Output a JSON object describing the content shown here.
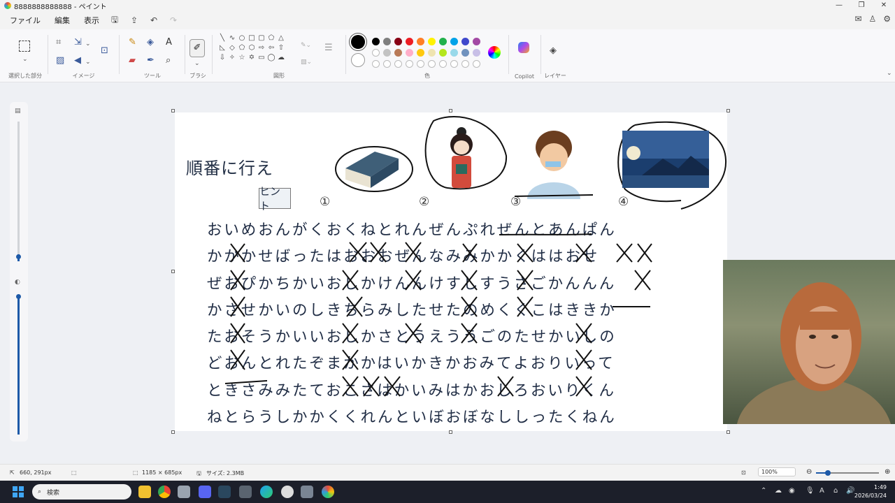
{
  "window": {
    "title": "8888888888888 - ペイント",
    "controls": [
      "—",
      "❐",
      "✕"
    ]
  },
  "menu": {
    "items": [
      "ファイル",
      "編集",
      "表示"
    ]
  },
  "ribbon": {
    "groups": {
      "selection": "選択した部分",
      "image": "イメージ",
      "tools": "ツール",
      "brushes": "ブラシ",
      "shapes": "図形",
      "colors": "色",
      "copilot": "Copilot",
      "layers": "レイヤー"
    },
    "text_tool": "A",
    "palette_top": [
      "#000000",
      "#7f7f7f",
      "#880015",
      "#ed1c24",
      "#ff7f27",
      "#fff200",
      "#22b14c",
      "#00a2e8",
      "#3f48cc",
      "#a349a4"
    ],
    "palette_mid": [
      "#ffffff",
      "#c3c3c3",
      "#b97a57",
      "#ffaec9",
      "#ffc90e",
      "#efe4b0",
      "#b5e61d",
      "#99d9ea",
      "#7092be",
      "#c8bfe7"
    ]
  },
  "canvas": {
    "title": "順番に行え",
    "hint": "ヒント",
    "numbers": [
      "①",
      "②",
      "③",
      "④"
    ],
    "lines": [
      "おいめおんがくおくねとれんぜんぷれぜんとあんぱん",
      "かかかせばったはおおおぜんなみみかかくははおせ",
      "ぜおぴかちかいおしかけんんけすしすうさごかんんん",
      "かさせかいのしきちらみしたせたのめくくこはききか",
      "たおそうかいいおしかさとうえううごのたせかいしの",
      "どおんとれたぞまかかはいかきかおみてよおりいって",
      "ときさみみたておこさはかいみはかおしろおいりくん",
      "ねとらうしかかくくれんといぼおぼなししったくねん"
    ]
  },
  "status": {
    "cursor": "660, 291px",
    "dimensions": "1185 × 685px",
    "size": "サイズ: 2.3MB",
    "zoom": "100%",
    "zoom_fraction": 0.18
  },
  "taskbar": {
    "search_placeholder": "検索",
    "time": "1:49",
    "date": "2026/03/24"
  },
  "colors": {
    "accent": "#1e5aa8",
    "ink": "#1f2c44"
  }
}
